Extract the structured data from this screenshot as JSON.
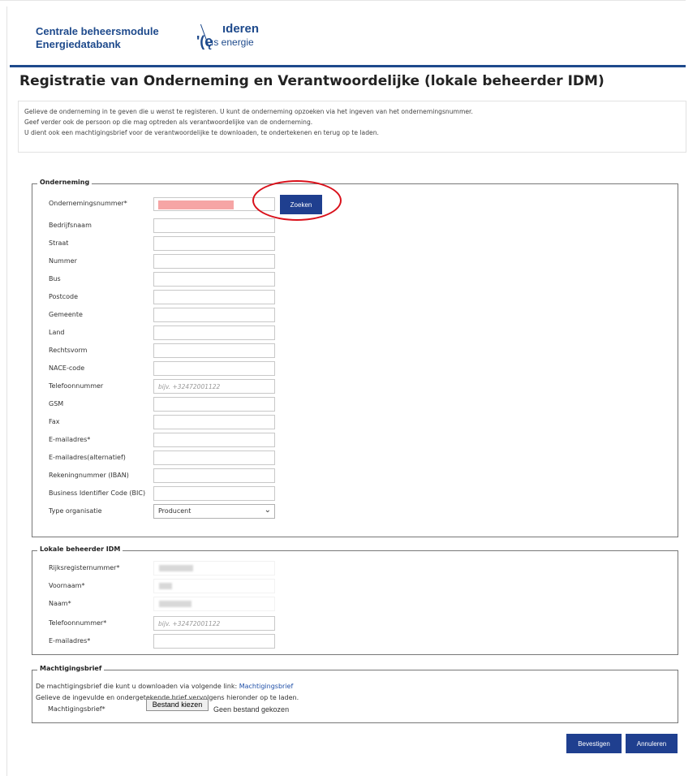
{
  "header": {
    "brand_line1": "Centrale beheersmodule",
    "brand_line2": "Energiedatabank",
    "logo_line1": "ıderen",
    "logo_line2": "ıs energie",
    "logo_mark": "'(ę"
  },
  "page_title": "Registratie van Onderneming en Verantwoordelijke (lokale beheerder IDM)",
  "intro": [
    "Gelieve de onderneming in te geven die u wenst te registeren. U kunt de onderneming opzoeken via het ingeven van het ondernemingsnummer.",
    "Geef verder ook de persoon op die mag optreden als verantwoordelijke van de onderneming.",
    "U dient ook een machtigingsbrief voor de verantwoordelijke te downloaden, te ondertekenen en terug op te laden."
  ],
  "onderneming": {
    "legend": "Onderneming",
    "search_button": "Zoeken",
    "fields": [
      {
        "label": "Ondernemingsnummer*",
        "value": "",
        "placeholder": ""
      },
      {
        "label": "Bedrijfsnaam",
        "value": "",
        "placeholder": ""
      },
      {
        "label": "Straat",
        "value": "",
        "placeholder": ""
      },
      {
        "label": "Nummer",
        "value": "",
        "placeholder": ""
      },
      {
        "label": "Bus",
        "value": "",
        "placeholder": ""
      },
      {
        "label": "Postcode",
        "value": "",
        "placeholder": ""
      },
      {
        "label": "Gemeente",
        "value": "",
        "placeholder": ""
      },
      {
        "label": "Land",
        "value": "",
        "placeholder": ""
      },
      {
        "label": "Rechtsvorm",
        "value": "",
        "placeholder": ""
      },
      {
        "label": "NACE-code",
        "value": "",
        "placeholder": ""
      },
      {
        "label": "Telefoonnummer",
        "value": "",
        "placeholder": "bijv. +32472001122"
      },
      {
        "label": "GSM",
        "value": "",
        "placeholder": ""
      },
      {
        "label": "Fax",
        "value": "",
        "placeholder": ""
      },
      {
        "label": "E-mailadres*",
        "value": "",
        "placeholder": ""
      },
      {
        "label": "E-mailadres(alternatief)",
        "value": "",
        "placeholder": ""
      },
      {
        "label": "Rekeningnummer (IBAN)",
        "value": "",
        "placeholder": ""
      },
      {
        "label": "Business Identifier Code (BIC)",
        "value": "",
        "placeholder": ""
      }
    ],
    "type_label": "Type organisatie",
    "type_value": "Producent"
  },
  "beheerder": {
    "legend": "Lokale beheerder IDM",
    "fields": [
      {
        "label": "Rijksregisternummer*",
        "placeholder": ""
      },
      {
        "label": "Voornaam*",
        "placeholder": ""
      },
      {
        "label": "Naam*",
        "placeholder": ""
      },
      {
        "label": "Telefoonnummer*",
        "placeholder": "bijv. +32472001122"
      },
      {
        "label": "E-mailadres*",
        "placeholder": ""
      }
    ]
  },
  "machtiging": {
    "legend": "Machtigingsbrief",
    "line1_text": "De machtigingsbrief die kunt u downloaden via volgende link: ",
    "line1_link": "Machtigingsbrief",
    "line2_text": "Gelieve de ingevulde en ondergetekende brief vervolgens hieronder op te laden.",
    "file_label": "Machtigingsbrief*",
    "file_button": "Bestand kiezen",
    "file_status": "Geen bestand gekozen"
  },
  "actions": {
    "confirm": "Bevestigen",
    "cancel": "Annuleren"
  },
  "colors": {
    "brand": "#1e4a8c",
    "button": "#1f3f8f",
    "highlight": "#d9111b"
  }
}
